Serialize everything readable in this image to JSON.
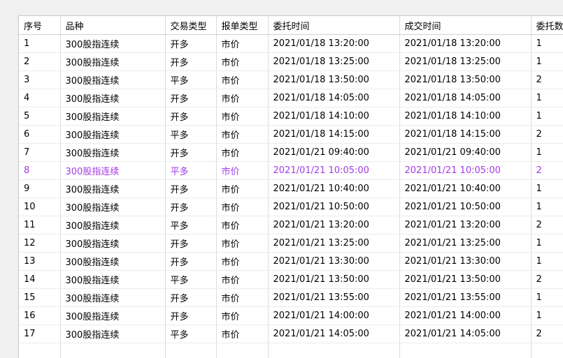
{
  "columns": [
    "序号",
    "品种",
    "交易类型",
    "报单类型",
    "委托时间",
    "成交时间",
    "委托数量"
  ],
  "highlight_color": "#a23ae8",
  "rows": [
    [
      "1",
      "300股指连续",
      "开多",
      "市价",
      "2021/01/18 13:20:00",
      "2021/01/18 13:20:00",
      "1"
    ],
    [
      "2",
      "300股指连续",
      "开多",
      "市价",
      "2021/01/18 13:25:00",
      "2021/01/18 13:25:00",
      "1"
    ],
    [
      "3",
      "300股指连续",
      "平多",
      "市价",
      "2021/01/18 13:50:00",
      "2021/01/18 13:50:00",
      "2"
    ],
    [
      "4",
      "300股指连续",
      "开多",
      "市价",
      "2021/01/18 14:05:00",
      "2021/01/18 14:05:00",
      "1"
    ],
    [
      "5",
      "300股指连续",
      "开多",
      "市价",
      "2021/01/18 14:10:00",
      "2021/01/18 14:10:00",
      "1"
    ],
    [
      "6",
      "300股指连续",
      "平多",
      "市价",
      "2021/01/18 14:15:00",
      "2021/01/18 14:15:00",
      "2"
    ],
    [
      "7",
      "300股指连续",
      "开多",
      "市价",
      "2021/01/21 09:40:00",
      "2021/01/21 09:40:00",
      "1"
    ],
    [
      "8",
      "300股指连续",
      "平多",
      "市价",
      "2021/01/21 10:05:00",
      "2021/01/21 10:05:00",
      "2"
    ],
    [
      "9",
      "300股指连续",
      "开多",
      "市价",
      "2021/01/21 10:40:00",
      "2021/01/21 10:40:00",
      "1"
    ],
    [
      "10",
      "300股指连续",
      "开多",
      "市价",
      "2021/01/21 10:50:00",
      "2021/01/21 10:50:00",
      "1"
    ],
    [
      "11",
      "300股指连续",
      "平多",
      "市价",
      "2021/01/21 13:20:00",
      "2021/01/21 13:20:00",
      "2"
    ],
    [
      "12",
      "300股指连续",
      "开多",
      "市价",
      "2021/01/21 13:25:00",
      "2021/01/21 13:25:00",
      "1"
    ],
    [
      "13",
      "300股指连续",
      "开多",
      "市价",
      "2021/01/21 13:30:00",
      "2021/01/21 13:30:00",
      "1"
    ],
    [
      "14",
      "300股指连续",
      "平多",
      "市价",
      "2021/01/21 13:50:00",
      "2021/01/21 13:50:00",
      "2"
    ],
    [
      "15",
      "300股指连续",
      "开多",
      "市价",
      "2021/01/21 13:55:00",
      "2021/01/21 13:55:00",
      "1"
    ],
    [
      "16",
      "300股指连续",
      "开多",
      "市价",
      "2021/01/21 14:00:00",
      "2021/01/21 14:00:00",
      "1"
    ],
    [
      "17",
      "300股指连续",
      "平多",
      "市价",
      "2021/01/21 14:05:00",
      "2021/01/21 14:05:00",
      "2"
    ]
  ],
  "selected_row": 7
}
